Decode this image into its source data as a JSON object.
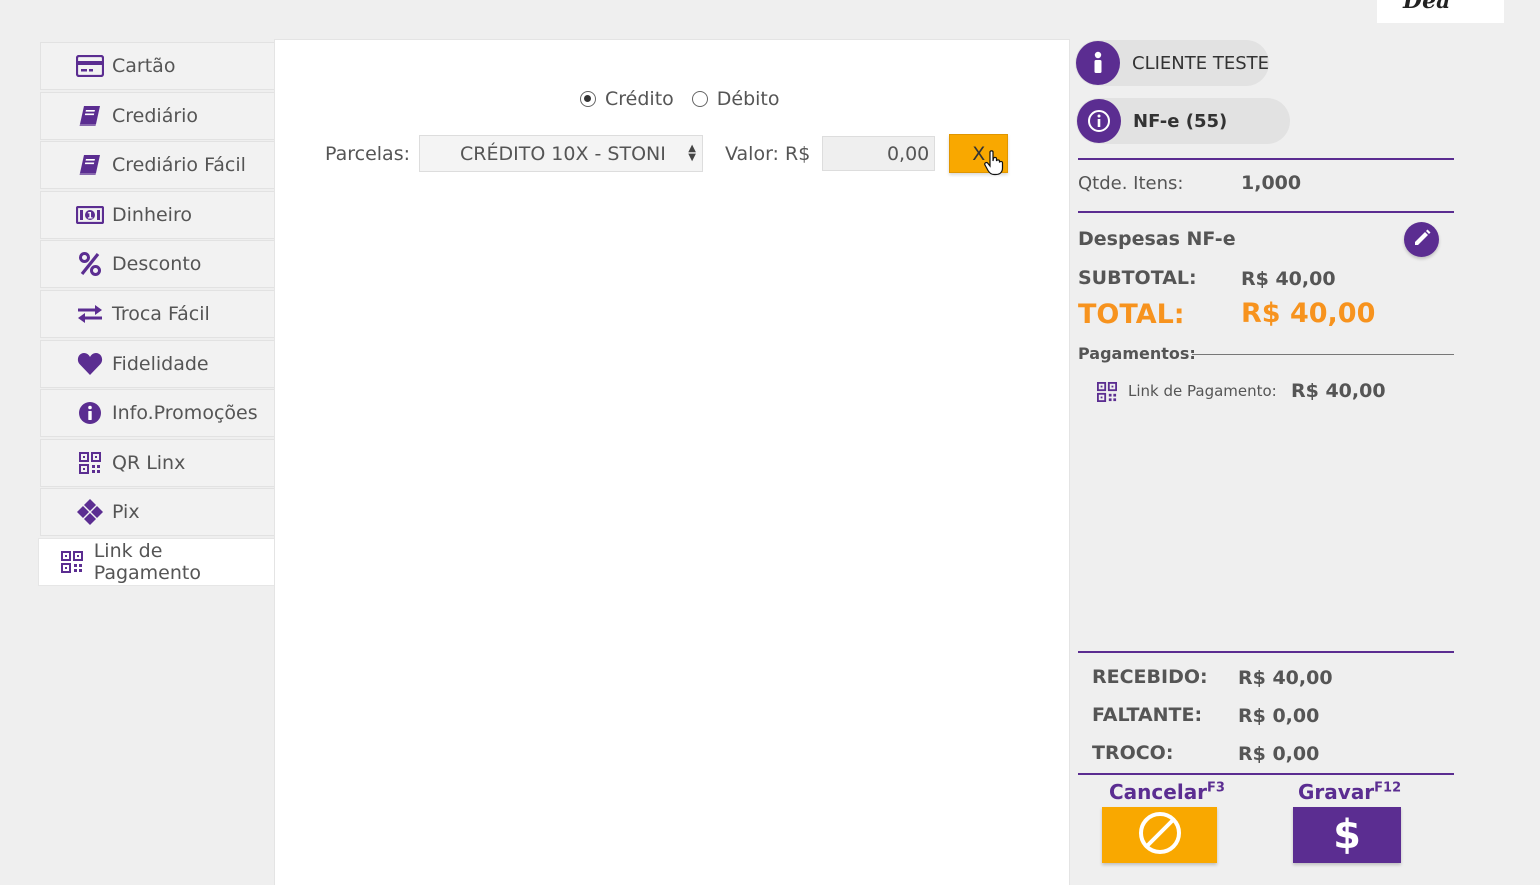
{
  "sidebar": {
    "items": [
      {
        "label": "Cartão",
        "icon": "credit-card-icon"
      },
      {
        "label": "Crediário",
        "icon": "book-icon"
      },
      {
        "label": "Crediário Fácil",
        "icon": "book-icon"
      },
      {
        "label": "Dinheiro",
        "icon": "money-icon"
      },
      {
        "label": "Desconto",
        "icon": "percent-icon"
      },
      {
        "label": "Troca Fácil",
        "icon": "exchange-icon"
      },
      {
        "label": "Fidelidade",
        "icon": "heart-icon"
      },
      {
        "label": "Info.Promoções",
        "icon": "info-icon"
      },
      {
        "label": "QR Linx",
        "icon": "qrcode-icon"
      },
      {
        "label": "Pix",
        "icon": "pix-icon"
      },
      {
        "label": "Link de Pagamento",
        "icon": "qrcode-icon",
        "active": true
      }
    ]
  },
  "payment": {
    "credit_label": "Crédito",
    "debit_label": "Débito",
    "selected_type": "Crédito",
    "installments_label": "Parcelas:",
    "installments_value": "CRÉDITO 10X - STONI",
    "amount_label": "Valor: R$",
    "amount_value": "0,00",
    "clear_label": "X"
  },
  "summary": {
    "client_name": "CLIENTE TESTE",
    "document_type": "NF-e (55)",
    "items_qty_label": "Qtde. Itens:",
    "items_qty_value": "1,000",
    "expenses_label": "Despesas NF-e",
    "subtotal_label": "SUBTOTAL:",
    "subtotal_value": "R$ 40,00",
    "total_label": "TOTAL:",
    "total_value": "R$ 40,00",
    "payments_label": "Pagamentos:",
    "payments": [
      {
        "method": "Link de Pagamento:",
        "value": "R$ 40,00",
        "icon": "qrcode-icon"
      }
    ],
    "received_label": "RECEBIDO:",
    "received_value": "R$ 40,00",
    "missing_label": "FALTANTE:",
    "missing_value": "R$ 0,00",
    "change_label": "TROCO:",
    "change_value": "R$ 0,00"
  },
  "actions": {
    "cancel_label": "Cancelar",
    "cancel_shortcut": "F3",
    "save_label": "Gravar",
    "save_shortcut": "F12",
    "save_symbol": "$"
  },
  "colors": {
    "brand_purple": "#5b2d91",
    "accent_orange": "#f9a800",
    "total_orange": "#f7931e"
  }
}
